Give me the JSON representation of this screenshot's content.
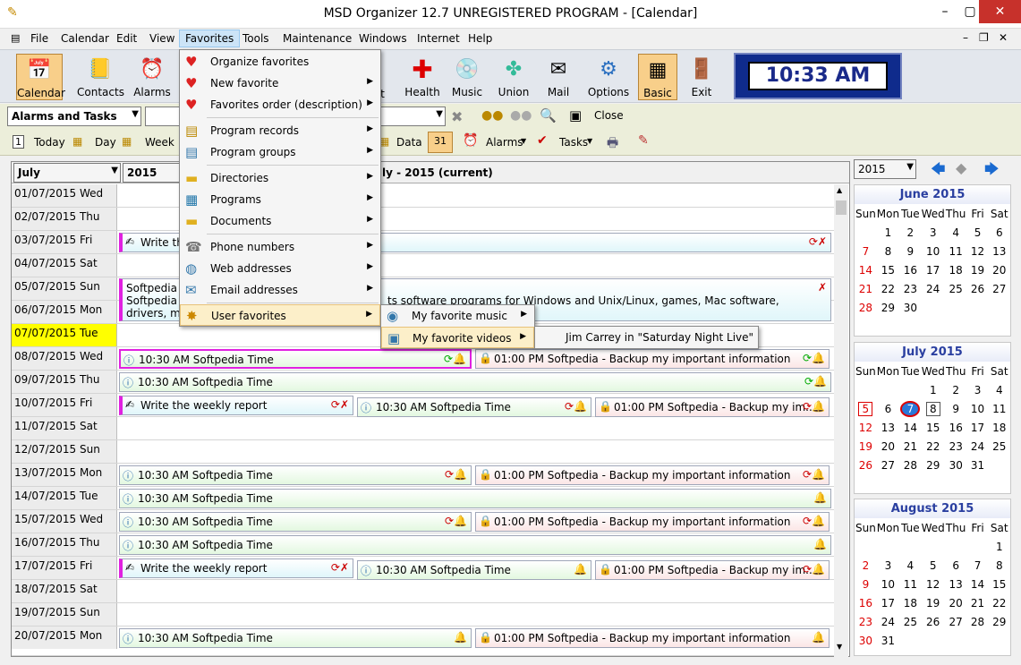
{
  "window": {
    "title": "MSD Organizer 12.7 UNREGISTERED PROGRAM - [Calendar]"
  },
  "menu": [
    "File",
    "Calendar",
    "Edit",
    "View",
    "Favorites",
    "Tools",
    "Maintenance",
    "Windows",
    "Internet",
    "Help"
  ],
  "toolbar": {
    "calendar": "Calendar",
    "contacts": "Contacts",
    "alarms": "Alarms",
    "get": "get",
    "health": "Health",
    "music": "Music",
    "union": "Union",
    "mail": "Mail",
    "options": "Options",
    "basic": "Basic",
    "exit": "Exit"
  },
  "clock": "10:33 AM",
  "row2": {
    "view_select": "Alarms and Tasks",
    "close": "Close"
  },
  "row3": {
    "today": "Today",
    "day": "Day",
    "week": "Week",
    "data": "Data",
    "alarms": "Alarms",
    "tasks": "Tasks"
  },
  "grid": {
    "month_select": "July",
    "year_select": "2015",
    "header": "ly - 2015 (current)"
  },
  "days": [
    "01/07/2015 Wed",
    "02/07/2015 Thu",
    "03/07/2015 Fri",
    "04/07/2015 Sat",
    "05/07/2015 Sun",
    "06/07/2015 Mon",
    "07/07/2015 Tue",
    "08/07/2015 Wed",
    "09/07/2015 Thu",
    "10/07/2015 Fri",
    "11/07/2015 Sat",
    "12/07/2015 Sun",
    "13/07/2015 Mon",
    "14/07/2015 Tue",
    "15/07/2015 Wed",
    "16/07/2015 Thu",
    "17/07/2015 Fri",
    "18/07/2015 Sat",
    "19/07/2015 Sun",
    "20/07/2015 Mon"
  ],
  "events": {
    "write": "Write the weekly report",
    "write_short": "Write the",
    "time": "10:30 AM Softpedia Time",
    "backup": "01:00 PM Softpedia - Backup my important information",
    "backup_short": "01:00 PM Softpedia - Backup my im...",
    "note_title": "Softpedia T",
    "note_body1": "Softpedia is",
    "note_body1b": "ts software programs for Windows and Unix/Linux, games, Mac software, Windows",
    "note_body2": "drivers, mo"
  },
  "side": {
    "year": "2015"
  },
  "calendar": {
    "dow": [
      "Sun",
      "Mon",
      "Tue",
      "Wed",
      "Thu",
      "Fri",
      "Sat"
    ],
    "june": {
      "title": "June 2015",
      "weeks": [
        [
          "",
          "1",
          "2",
          "3",
          "4",
          "5",
          "6"
        ],
        [
          "7",
          "8",
          "9",
          "10",
          "11",
          "12",
          "13"
        ],
        [
          "14",
          "15",
          "16",
          "17",
          "18",
          "19",
          "20"
        ],
        [
          "21",
          "22",
          "23",
          "24",
          "25",
          "26",
          "27"
        ],
        [
          "28",
          "29",
          "30",
          "",
          "",
          "",
          ""
        ]
      ]
    },
    "july": {
      "title": "July 2015",
      "weeks": [
        [
          "",
          "",
          "",
          "1",
          "2",
          "3",
          "4"
        ],
        [
          "5",
          "6",
          "7",
          "8",
          "9",
          "10",
          "11"
        ],
        [
          "12",
          "13",
          "14",
          "15",
          "16",
          "17",
          "18"
        ],
        [
          "19",
          "20",
          "21",
          "22",
          "23",
          "24",
          "25"
        ],
        [
          "26",
          "27",
          "28",
          "29",
          "30",
          "31",
          ""
        ]
      ]
    },
    "august": {
      "title": "August 2015",
      "weeks": [
        [
          "",
          "",
          "",
          "",
          "",
          "",
          "1"
        ],
        [
          "2",
          "3",
          "4",
          "5",
          "6",
          "7",
          "8"
        ],
        [
          "9",
          "10",
          "11",
          "12",
          "13",
          "14",
          "15"
        ],
        [
          "16",
          "17",
          "18",
          "19",
          "20",
          "21",
          "22"
        ],
        [
          "23",
          "24",
          "25",
          "26",
          "27",
          "28",
          "29"
        ],
        [
          "30",
          "31",
          "",
          "",
          "",
          "",
          ""
        ]
      ]
    }
  },
  "favorites_menu": [
    "Organize favorites",
    "New favorite",
    "Favorites order (description)",
    "Program records",
    "Program groups",
    "Directories",
    "Programs",
    "Documents",
    "Phone numbers",
    "Web addresses",
    "Email addresses",
    "User favorites"
  ],
  "submenu": [
    "My favorite music",
    "My favorite videos"
  ],
  "submenu2": "Jim Carrey in \"Saturday Night Live\""
}
